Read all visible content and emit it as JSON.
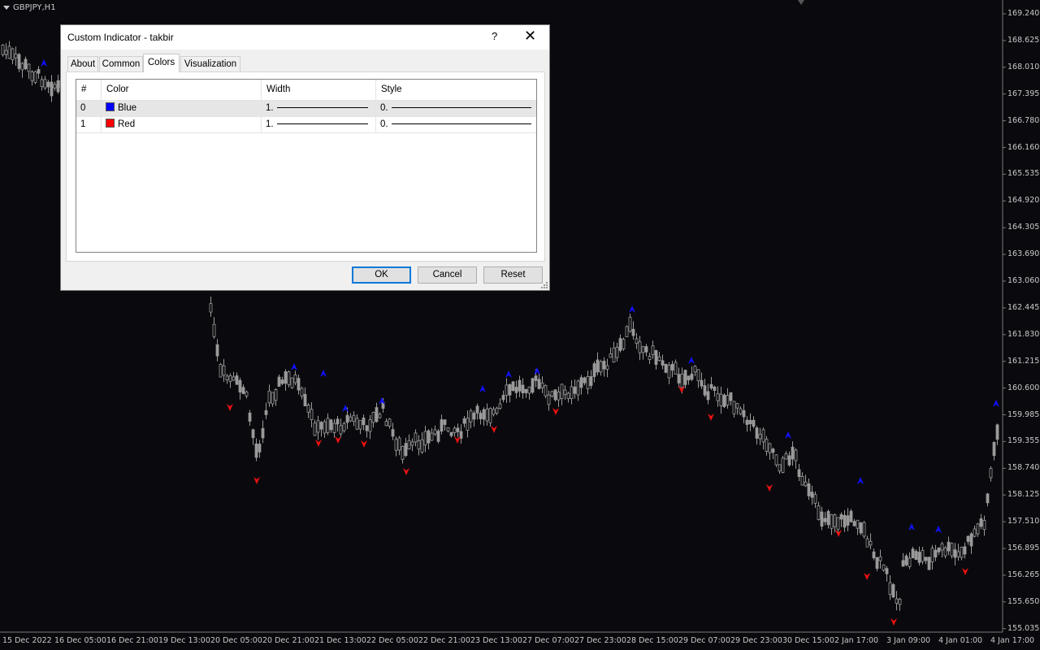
{
  "chart": {
    "symbol": "GBPJPY,H1",
    "price_labels": [
      "169.240",
      "168.625",
      "168.010",
      "167.395",
      "166.780",
      "166.160",
      "165.535",
      "164.920",
      "164.305",
      "163.690",
      "163.060",
      "162.445",
      "161.830",
      "161.215",
      "160.600",
      "159.985",
      "159.355",
      "158.740",
      "158.125",
      "157.510",
      "156.895",
      "156.265",
      "155.650",
      "155.035"
    ],
    "time_labels": [
      "15 Dec 2022",
      "16 Dec 05:00",
      "16 Dec 21:00",
      "19 Dec 13:00",
      "20 Dec 05:00",
      "20 Dec 21:00",
      "21 Dec 13:00",
      "22 Dec 05:00",
      "22 Dec 21:00",
      "23 Dec 13:00",
      "27 Dec 07:00",
      "27 Dec 23:00",
      "28 Dec 15:00",
      "29 Dec 07:00",
      "29 Dec 23:00",
      "30 Dec 15:00",
      "2 Jan 17:00",
      "3 Jan 09:00",
      "4 Jan 01:00",
      "4 Jan 17:00"
    ],
    "colors": {
      "background": "#0a0a0e",
      "candle": "#9a9a9a",
      "up_arrow": "#1010ff",
      "down_arrow": "#ee1010"
    }
  },
  "dialog": {
    "title": "Custom Indicator - takbir",
    "help_label": "?",
    "close_icon": "close-icon",
    "tabs": [
      {
        "label": "About"
      },
      {
        "label": "Common"
      },
      {
        "label": "Colors",
        "active": true
      },
      {
        "label": "Visualization"
      }
    ],
    "table": {
      "headers": [
        "#",
        "Color",
        "Width",
        "Style"
      ],
      "rows": [
        {
          "index": "0",
          "color_name": "Blue",
          "color": "#0000ff",
          "width": "1.",
          "style": "0."
        },
        {
          "index": "1",
          "color_name": "Red",
          "color": "#ff0000",
          "width": "1.",
          "style": "0."
        }
      ]
    },
    "buttons": {
      "ok": "OK",
      "cancel": "Cancel",
      "reset": "Reset"
    }
  }
}
